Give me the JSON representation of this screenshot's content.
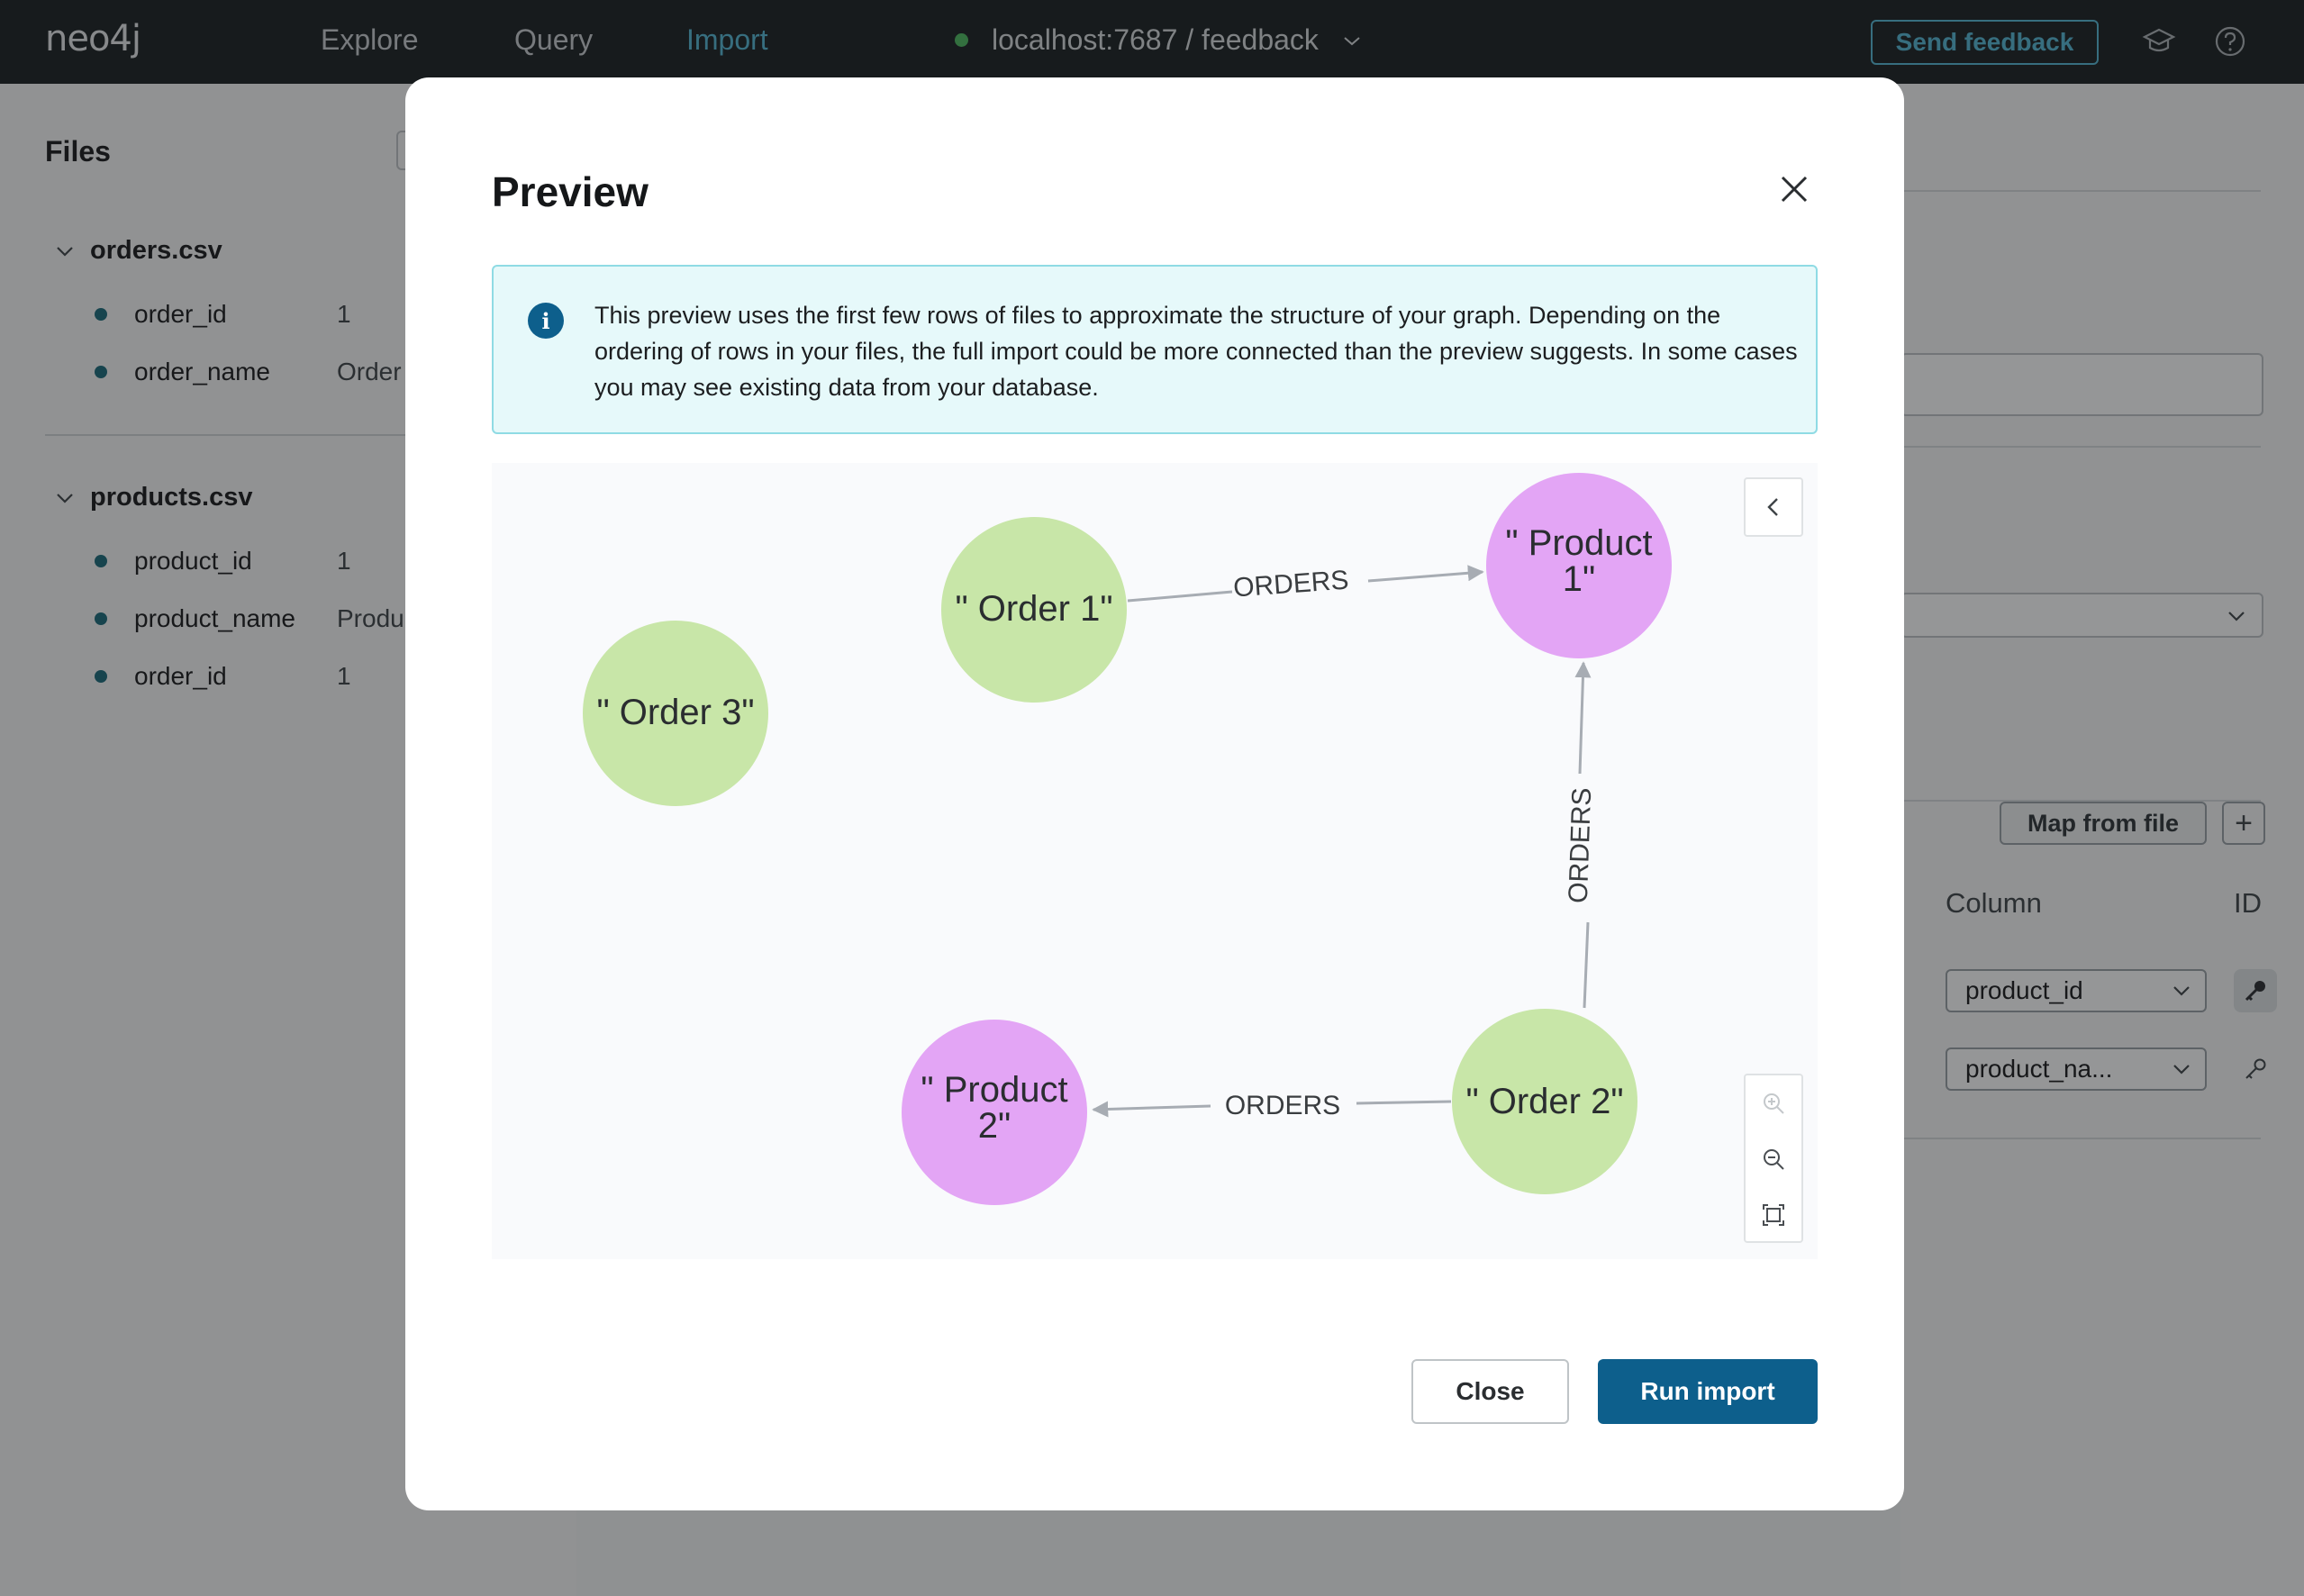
{
  "app": {
    "logo": "neo4j",
    "nav": [
      {
        "label": "Explore"
      },
      {
        "label": "Query"
      },
      {
        "label": "Import"
      }
    ],
    "active_nav": "Import",
    "connection": "localhost:7687 / feedback",
    "connection_status_color": "#4dbb5f",
    "send_feedback_label": "Send feedback",
    "accent_color": "#55b7d3"
  },
  "files_panel": {
    "title": "Files",
    "files": [
      {
        "name": "orders.csv",
        "fields": [
          {
            "name": "order_id",
            "value": "1"
          },
          {
            "name": "order_name",
            "value": "Order"
          }
        ]
      },
      {
        "name": "products.csv",
        "fields": [
          {
            "name": "product_id",
            "value": "1"
          },
          {
            "name": "product_name",
            "value": "Produ"
          },
          {
            "name": "order_id",
            "value": "1"
          }
        ]
      }
    ]
  },
  "mapping_panel": {
    "map_from_file_label": "Map from file",
    "add_label": "+",
    "column_header": "Column",
    "id_header": "ID",
    "rows": [
      {
        "column": "product_id",
        "is_id": true
      },
      {
        "column": "product_na...",
        "is_id": false
      }
    ]
  },
  "modal": {
    "title": "Preview",
    "info": "This preview uses the first few rows of files to approximate the structure of your graph. Depending on the ordering of rows in your files, the full import could be more connected than the preview suggests. In some cases you may see existing data from your database.",
    "close_label": "Close",
    "run_label": "Run import",
    "primary_color": "#0d5f8c",
    "graph": {
      "nodes": [
        {
          "id": "order1",
          "label": "\" Order 1\"",
          "type": "Order"
        },
        {
          "id": "product1",
          "label": "\" Product 1\"",
          "type": "Product"
        },
        {
          "id": "order3",
          "label": "\" Order 3\"",
          "type": "Order"
        },
        {
          "id": "order2",
          "label": "\" Order 2\"",
          "type": "Order"
        },
        {
          "id": "product2",
          "label": "\" Product 2\"",
          "type": "Product"
        }
      ],
      "relationships": [
        {
          "from": "order1",
          "to": "product1",
          "label": "ORDERS"
        },
        {
          "from": "order2",
          "to": "product1",
          "label": "ORDERS"
        },
        {
          "from": "order2",
          "to": "product2",
          "label": "ORDERS"
        }
      ],
      "colors": {
        "Order": "#c8e6a8",
        "Product": "#e3a5f5",
        "edge": "#a7acb3"
      }
    }
  }
}
